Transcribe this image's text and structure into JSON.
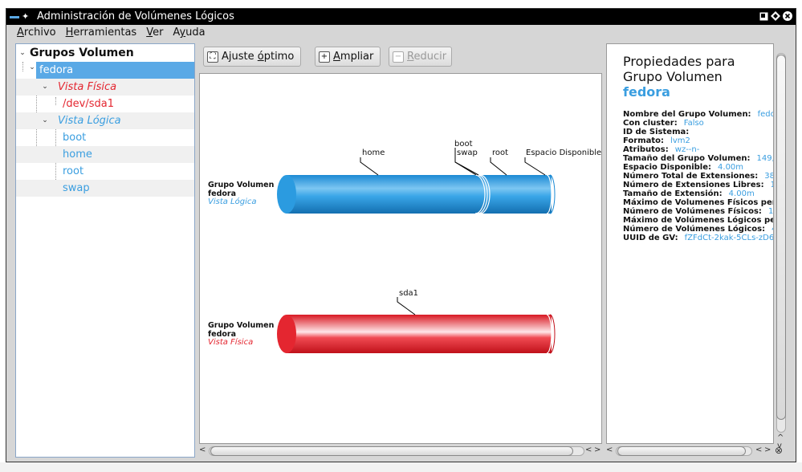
{
  "window": {
    "title": "Administración de Volúmenes Lógicos"
  },
  "menu": {
    "items": [
      {
        "label": "Archivo",
        "accel": "A",
        "rest": "rchivo"
      },
      {
        "label": "Herramientas",
        "accel": "H",
        "rest": "erramientas"
      },
      {
        "label": "Ver",
        "accel": "V",
        "rest": "er"
      },
      {
        "label": "Ayuda",
        "accel": "y",
        "pre": "A",
        "rest": "uda"
      }
    ]
  },
  "tree": {
    "root": "Grupos Volumen",
    "group": "fedora",
    "physical_view": "Vista Física",
    "pv": "/dev/sda1",
    "logical_view": "Vista Lógica",
    "lvs": [
      "boot",
      "home",
      "root",
      "swap"
    ]
  },
  "toolbar": {
    "fit": {
      "pre": "Ajuste ",
      "accel": "ó",
      "post": "ptimo"
    },
    "zoom_in": {
      "pre": "",
      "accel": "A",
      "post": "mpliar"
    },
    "zoom_out": {
      "pre": "",
      "accel": "R",
      "post": "educir"
    }
  },
  "diagram": {
    "logical": {
      "group_label": "Grupo Volumen",
      "group_name": "fedora",
      "view_label": "Vista Lógica",
      "segments": [
        "home",
        "boot",
        "swap",
        "root",
        "Espacio Disponible"
      ],
      "color": "#2b9be0"
    },
    "physical": {
      "group_label": "Grupo Volumen",
      "group_name": "fedora",
      "view_label": "Vista Física",
      "segments": [
        "sda1"
      ],
      "color": "#e42630"
    }
  },
  "properties": {
    "title_line1": "Propiedades para",
    "title_line2": "Grupo Volumen",
    "name": "fedora",
    "rows": [
      {
        "label": "Nombre del Grupo Volumen:",
        "value": "fedo"
      },
      {
        "label": "Con cluster:",
        "value": "Falso"
      },
      {
        "label": "ID de Sistema:",
        "value": ""
      },
      {
        "label": "Formato:",
        "value": "lvm2"
      },
      {
        "label": "Atributos:",
        "value": "wz--n-"
      },
      {
        "label": "Tamaño del Grupo Volumen:",
        "value": "149,"
      },
      {
        "label": "Espacio Disponible:",
        "value": "4.00m"
      },
      {
        "label": "Número Total de Extensiones:",
        "value": "38"
      },
      {
        "label": "Número de Extensiones Libres:",
        "value": "1"
      },
      {
        "label": "Tamaño de Extensión:",
        "value": "4.00m"
      },
      {
        "label": "Máximo de Volumenes Físicos per",
        "value": ""
      },
      {
        "label": "Número de Volúmenes Físicos:",
        "value": "1"
      },
      {
        "label": "Máximo de Volúmenes Lógicos pe",
        "value": ""
      },
      {
        "label": "Número de Volúmenes Lógicos:",
        "value": "4"
      },
      {
        "label": "UUID de GV:",
        "value": "fZFdCt-2kak-5CLs-zD6"
      }
    ]
  }
}
